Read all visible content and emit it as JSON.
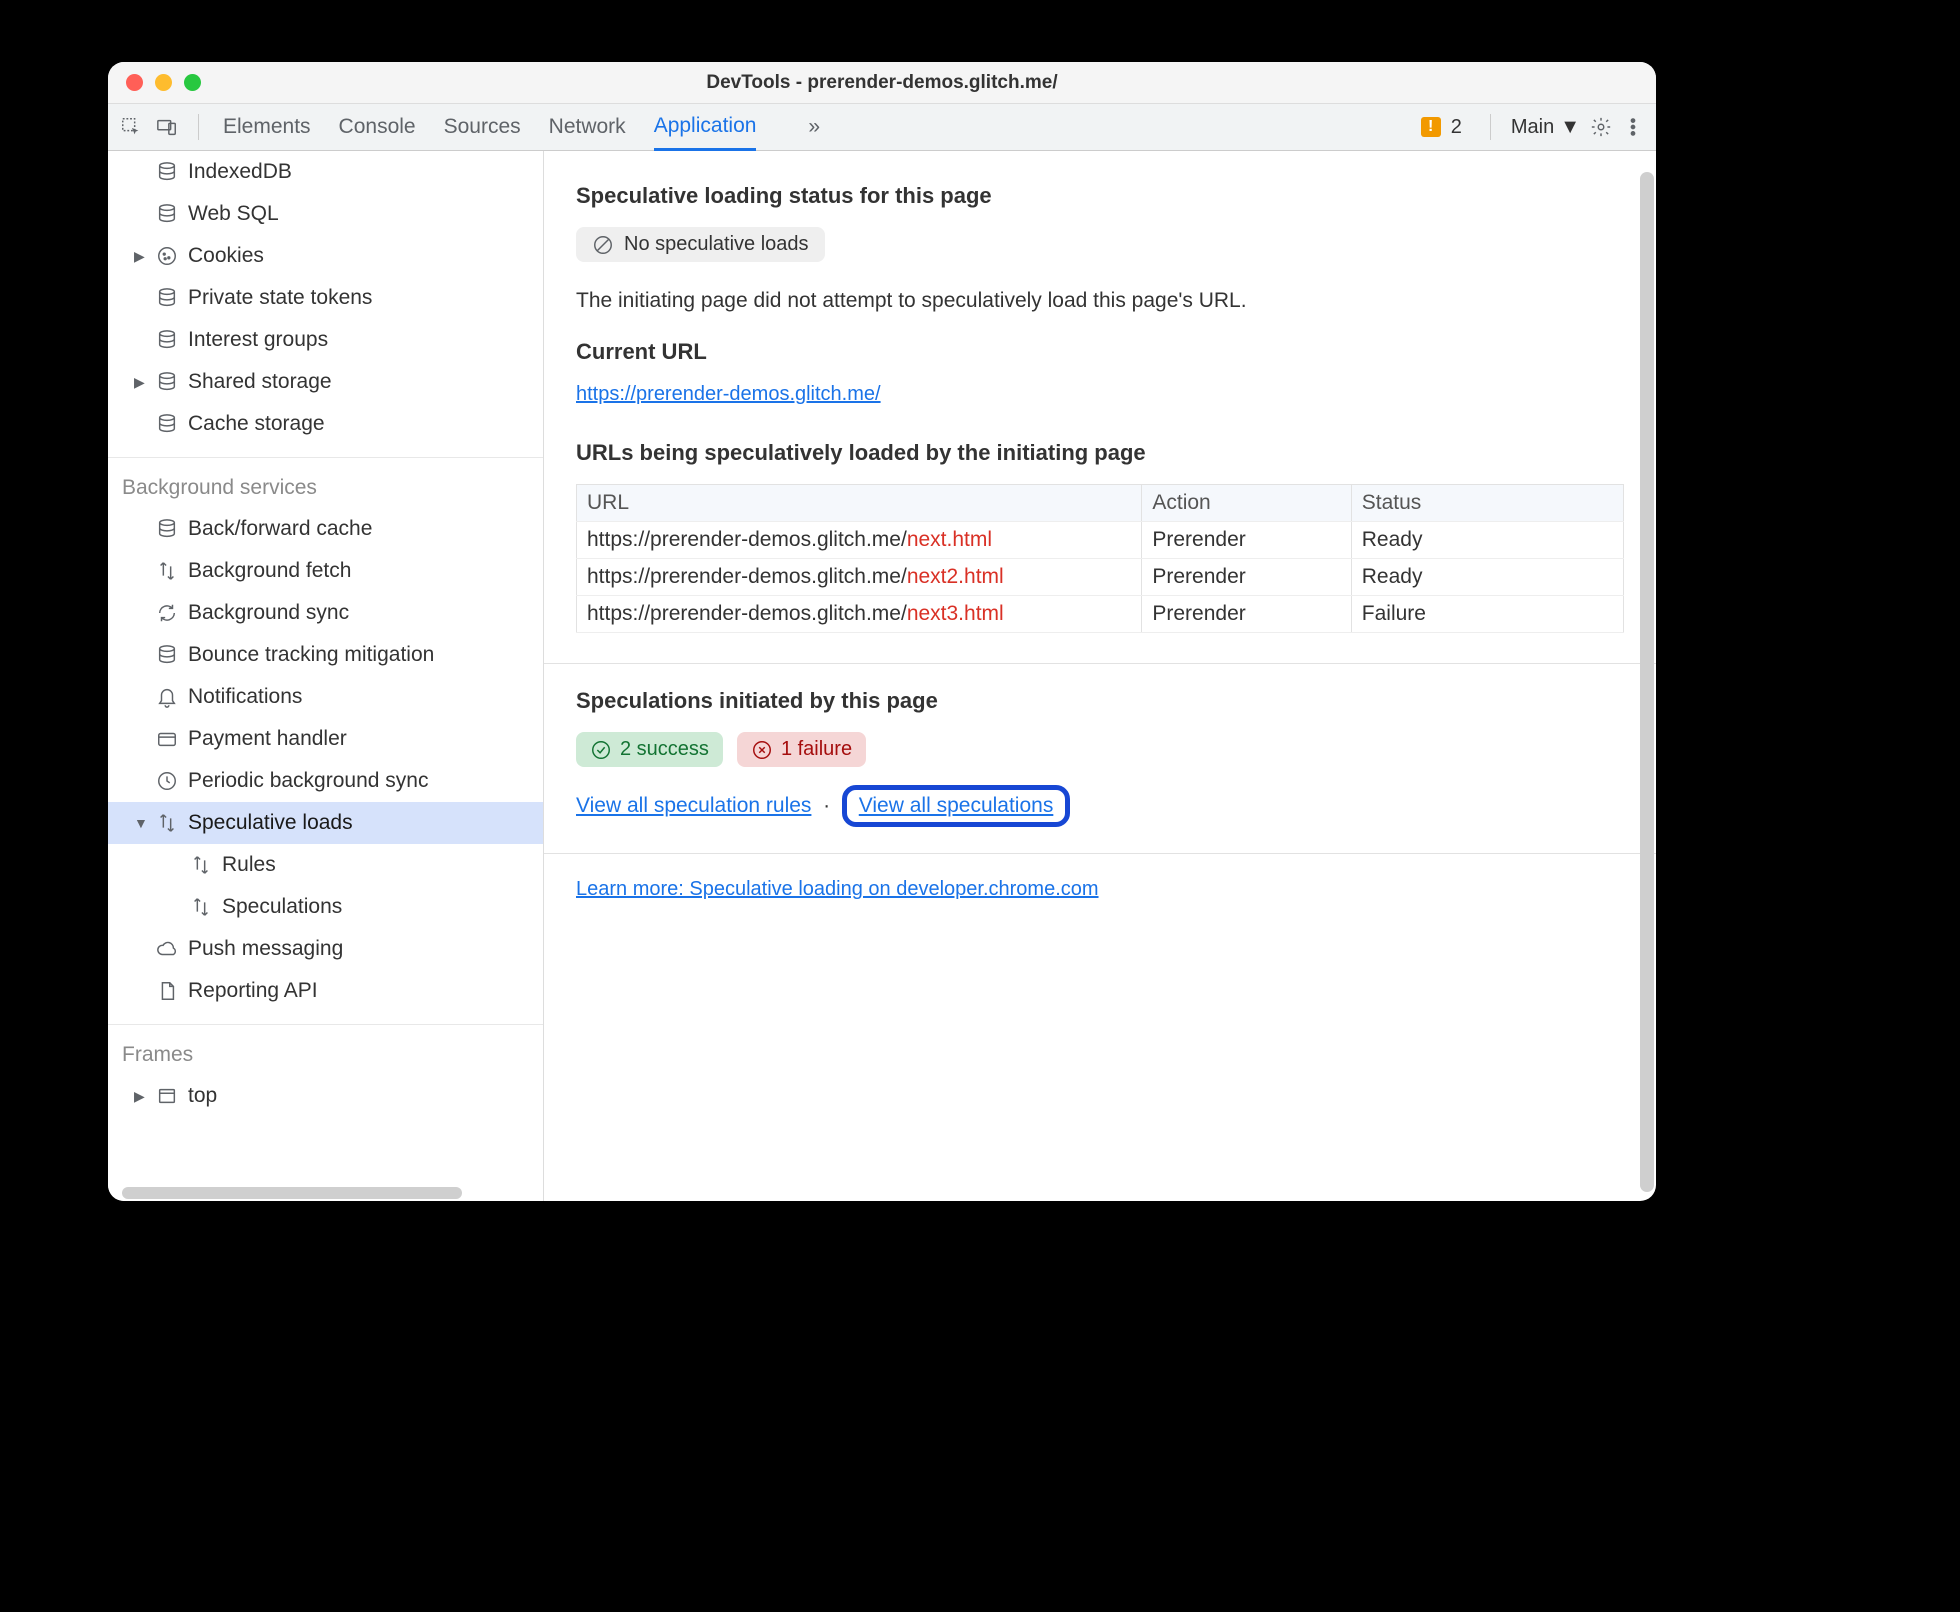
{
  "window_title": "DevTools - prerender-demos.glitch.me/",
  "tabs": {
    "elements": "Elements",
    "console": "Console",
    "sources": "Sources",
    "network": "Network",
    "application": "Application"
  },
  "toolbar": {
    "warn_count": "2",
    "target": "Main"
  },
  "sidebar": {
    "storage": {
      "indexeddb": "IndexedDB",
      "websql": "Web SQL",
      "cookies": "Cookies",
      "pst": "Private state tokens",
      "interest": "Interest groups",
      "shared": "Shared storage",
      "cache": "Cache storage"
    },
    "bg_label": "Background services",
    "bg": {
      "bfcache": "Back/forward cache",
      "bgfetch": "Background fetch",
      "bgsync": "Background sync",
      "bounce": "Bounce tracking mitigation",
      "notif": "Notifications",
      "payment": "Payment handler",
      "periodic": "Periodic background sync",
      "specloads": "Speculative loads",
      "rules": "Rules",
      "speculations": "Speculations",
      "push": "Push messaging",
      "reporting": "Reporting API"
    },
    "frames_label": "Frames",
    "frames": {
      "top": "top"
    }
  },
  "main": {
    "status_title": "Speculative loading status for this page",
    "no_spec": "No speculative loads",
    "status_desc": "The initiating page did not attempt to speculatively load this page's URL.",
    "current_url_label": "Current URL",
    "current_url": "https://prerender-demos.glitch.me/",
    "urls_title": "URLs being speculatively loaded by the initiating page",
    "table": {
      "col_url": "URL",
      "col_action": "Action",
      "col_status": "Status",
      "rows": [
        {
          "base": "https://prerender-demos.glitch.me/",
          "leaf": "next.html",
          "action": "Prerender",
          "status": "Ready"
        },
        {
          "base": "https://prerender-demos.glitch.me/",
          "leaf": "next2.html",
          "action": "Prerender",
          "status": "Ready"
        },
        {
          "base": "https://prerender-demos.glitch.me/",
          "leaf": "next3.html",
          "action": "Prerender",
          "status": "Failure"
        }
      ]
    },
    "spec_init_title": "Speculations initiated by this page",
    "success": "2 success",
    "failure": "1 failure",
    "view_rules": "View all speculation rules",
    "view_specs": "View all speculations",
    "learn_more": "Learn more: Speculative loading on developer.chrome.com"
  }
}
